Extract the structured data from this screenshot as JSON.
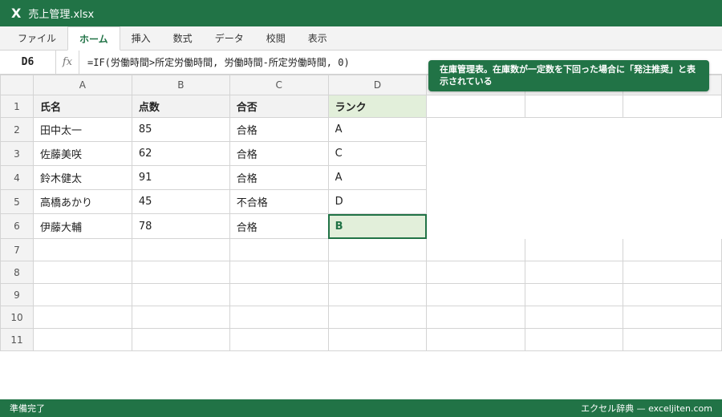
{
  "app": {
    "icon_letter": "X",
    "file_name": "売上管理.xlsx"
  },
  "ribbon": {
    "tabs": [
      "ファイル",
      "ホーム",
      "挿入",
      "数式",
      "データ",
      "校閲",
      "表示"
    ],
    "active_tab": "ホーム"
  },
  "formula_bar": {
    "cell_ref": "D6",
    "fx_label": "fx",
    "formula": "=IF(労働時間>所定労働時間, 労働時間-所定労働時間, 0)"
  },
  "columns": [
    "A",
    "B",
    "C",
    "D"
  ],
  "rows": [
    {
      "num": "1",
      "cells": [
        "氏名",
        "点数",
        "合否",
        "ランク"
      ]
    },
    {
      "num": "2",
      "cells": [
        "田中太一",
        "85",
        "合格",
        "A"
      ]
    },
    {
      "num": "3",
      "cells": [
        "佐藤美咲",
        "62",
        "合格",
        "C"
      ]
    },
    {
      "num": "4",
      "cells": [
        "鈴木健太",
        "91",
        "合格",
        "A"
      ]
    },
    {
      "num": "5",
      "cells": [
        "高橋あかり",
        "45",
        "不合格",
        "D"
      ]
    },
    {
      "num": "6",
      "cells": [
        "伊藤大輔",
        "78",
        "合格",
        "B"
      ]
    },
    {
      "num": "7",
      "cells": [
        "",
        "",
        "",
        ""
      ]
    },
    {
      "num": "8",
      "cells": [
        "",
        "",
        "",
        ""
      ]
    },
    {
      "num": "9",
      "cells": [
        "",
        "",
        "",
        ""
      ]
    },
    {
      "num": "10",
      "cells": [
        "",
        "",
        "",
        ""
      ]
    },
    {
      "num": "11",
      "cells": [
        "",
        "",
        "",
        ""
      ]
    }
  ],
  "selected_cell": "D6",
  "callout": {
    "text": "在庫管理表。在庫数が一定数を下回った場合に「発注推奨」と表示されている"
  },
  "status_bar": {
    "left": "準備完了",
    "right": "エクセル辞典 — exceljiten.com"
  },
  "colors": {
    "accent": "#217346",
    "selected_fill": "#e2efda",
    "header_fill": "#f2f2f2"
  }
}
